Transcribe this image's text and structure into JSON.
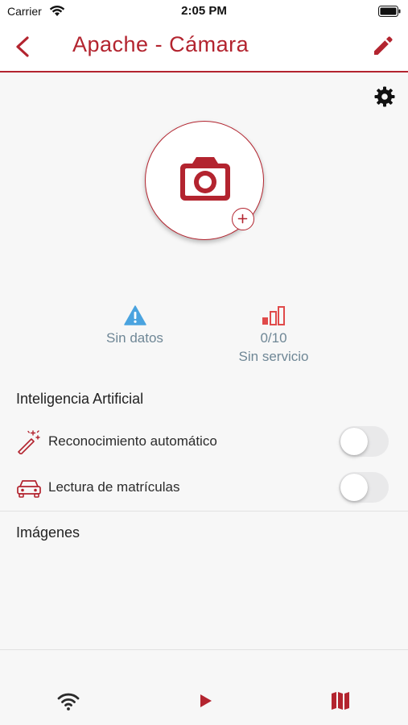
{
  "status_bar": {
    "carrier": "Carrier",
    "time": "2:05 PM"
  },
  "nav": {
    "title": "Apache - Cámara",
    "back_icon": "chevron-left-icon",
    "edit_icon": "pencil-icon"
  },
  "settings_icon": "gear-icon",
  "avatar": {
    "icon": "camera-icon",
    "badge_icon": "plus-icon"
  },
  "stats": {
    "data": {
      "icon": "warning-icon",
      "label": "Sin datos"
    },
    "service": {
      "icon": "signal-bars-icon",
      "count": "0/10",
      "label": "Sin servicio"
    }
  },
  "ai_section": {
    "title": "Inteligencia Artificial",
    "items": [
      {
        "icon": "magic-wand-icon",
        "label": "Reconocimiento automático",
        "enabled": false
      },
      {
        "icon": "car-icon",
        "label": "Lectura de matrículas",
        "enabled": false
      }
    ]
  },
  "images_section": {
    "title": "Imágenes"
  },
  "tab_bar": {
    "items": [
      {
        "icon": "wifi-icon"
      },
      {
        "icon": "play-icon"
      },
      {
        "icon": "map-icon"
      }
    ]
  },
  "colors": {
    "accent": "#b3242f",
    "muted_text": "#6f8796",
    "warning_blue": "#4aa3df",
    "signal_red": "#e04a4a",
    "background": "#f7f7f7"
  }
}
